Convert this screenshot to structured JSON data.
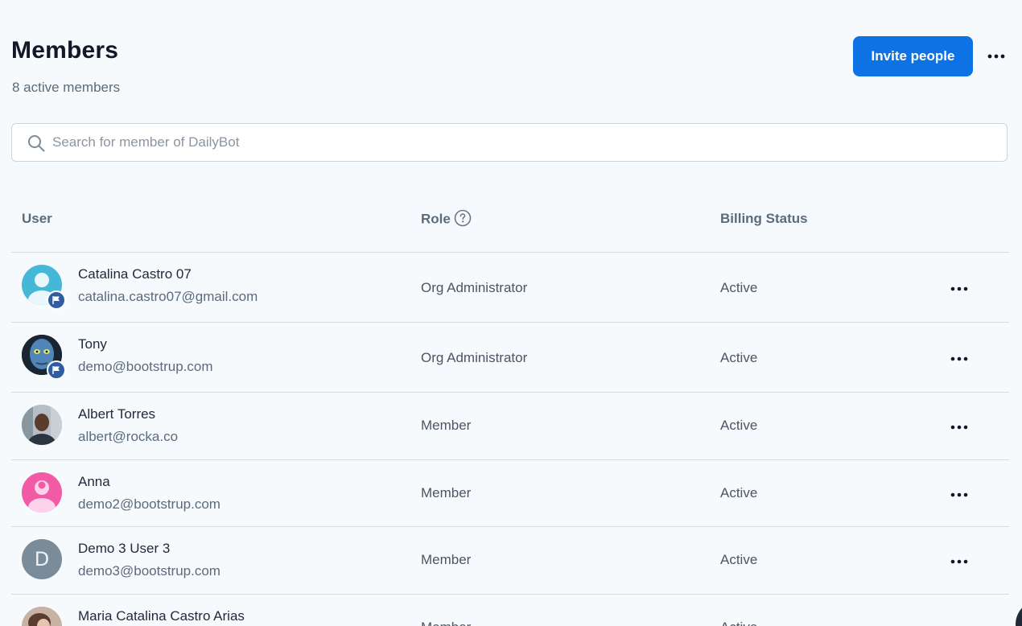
{
  "header": {
    "title": "Members",
    "subtitle": "8 active members",
    "invite_label": "Invite people"
  },
  "search": {
    "placeholder": "Search for member of DailyBot",
    "value": ""
  },
  "table": {
    "columns": [
      "User",
      "Role",
      "Billing Status"
    ],
    "rows": [
      {
        "name": "Catalina Castro 07",
        "email": "catalina.castro07@gmail.com",
        "role": "Org Administrator",
        "status": "Active",
        "avatar": "person-icon-cyan",
        "admin_badge": true
      },
      {
        "name": "Tony",
        "email": "demo@bootstrup.com",
        "role": "Org Administrator",
        "status": "Active",
        "avatar": "photo-blue-face",
        "admin_badge": true
      },
      {
        "name": "Albert Torres",
        "email": "albert@rocka.co",
        "role": "Member",
        "status": "Active",
        "avatar": "photo-man",
        "admin_badge": false
      },
      {
        "name": "Anna",
        "email": "demo2@bootstrup.com",
        "role": "Member",
        "status": "Active",
        "avatar": "person-icon-pink",
        "admin_badge": false
      },
      {
        "name": "Demo 3 User 3",
        "email": "demo3@bootstrup.com",
        "role": "Member",
        "status": "Active",
        "avatar": "initial-letter",
        "avatar_initial": "D",
        "admin_badge": false
      },
      {
        "name": "Maria Catalina Castro Arias",
        "email": "",
        "role": "Member",
        "status": "Active",
        "avatar": "photo-woman",
        "admin_badge": false
      }
    ]
  },
  "colors": {
    "accent": "#0d73e4",
    "background": "#f7fafd",
    "badge": "#2f5d9f"
  }
}
